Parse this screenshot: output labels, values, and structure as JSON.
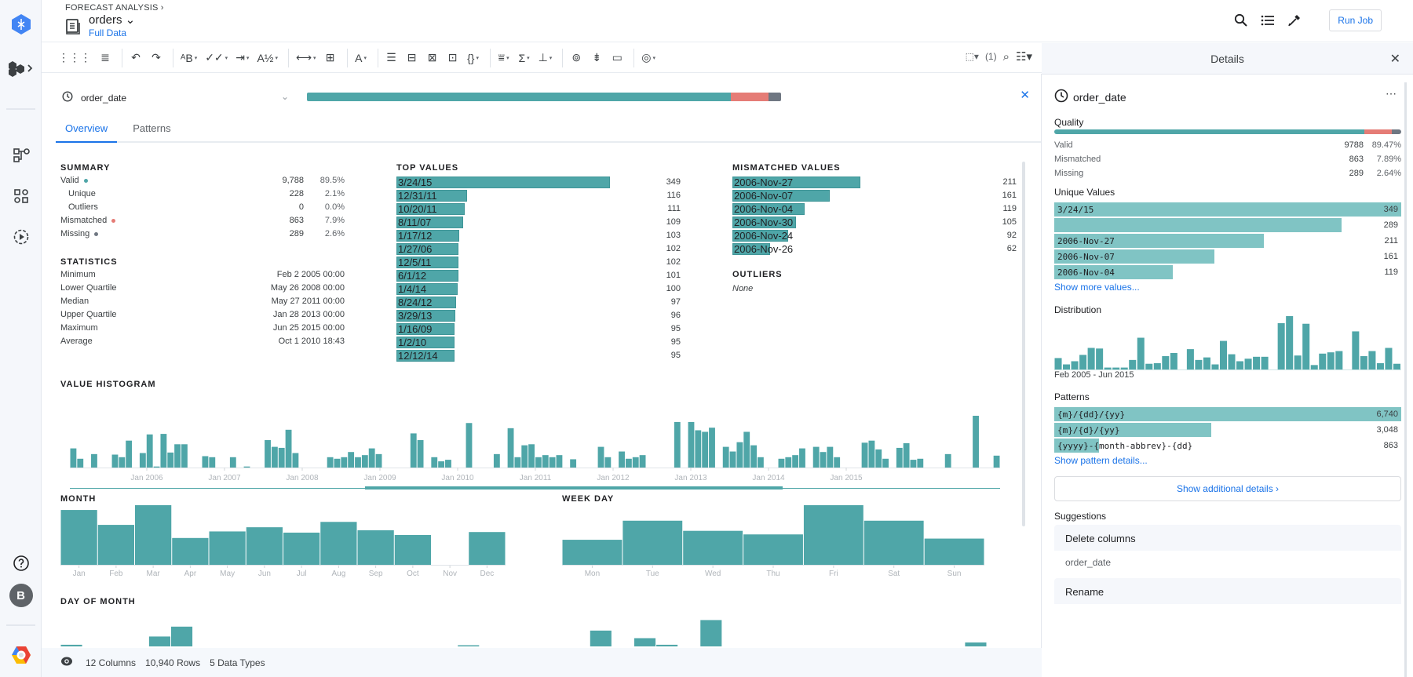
{
  "header": {
    "breadcrumb": "FORECAST ANALYSIS ›",
    "dataset_name": "orders ⌄",
    "dataset_sub": "Full Data",
    "run_job": "Run Job",
    "icons": [
      "search-icon",
      "list-icon",
      "eyedropper-icon"
    ]
  },
  "rail": {
    "avatar_letter": "B",
    "icons": [
      "dataprep-logo-icon",
      "flows-icon",
      "flow-diagram-icon",
      "grid-icon",
      "jobs-icon",
      "help-icon",
      "avatar",
      "gcp-logo-icon"
    ]
  },
  "toolbar": {
    "groups": [
      [
        {
          "name": "grid-view-icon",
          "glyph": "⋮⋮⋮"
        },
        {
          "name": "list-view-icon",
          "glyph": "≣"
        }
      ],
      [
        {
          "name": "undo-icon",
          "glyph": "↶"
        },
        {
          "name": "redo-icon",
          "glyph": "↷"
        }
      ],
      [
        {
          "name": "rename-icon",
          "glyph": "ᴬB",
          "caret": true
        },
        {
          "name": "validate-icon",
          "glyph": "✓✓",
          "caret": true
        },
        {
          "name": "move-icon",
          "glyph": "⇥",
          "caret": true
        },
        {
          "name": "sort-icon",
          "glyph": "A½",
          "caret": true
        }
      ],
      [
        {
          "name": "split-column-icon",
          "glyph": "⟷",
          "caret": true
        },
        {
          "name": "merge-column-icon",
          "glyph": "⊞"
        }
      ],
      [
        {
          "name": "text-format-icon",
          "glyph": "A",
          "caret": true
        }
      ],
      [
        {
          "name": "rows-icon",
          "glyph": "☰"
        },
        {
          "name": "unnest-icon",
          "glyph": "⊟"
        },
        {
          "name": "pivot-icon",
          "glyph": "⊠"
        },
        {
          "name": "transpose-icon",
          "glyph": "⊡"
        },
        {
          "name": "json-icon",
          "glyph": "{}",
          "caret": true
        }
      ],
      [
        {
          "name": "filter-icon",
          "glyph": "⩸",
          "caret": true
        },
        {
          "name": "aggregate-icon",
          "glyph": "Σ",
          "caret": true
        },
        {
          "name": "hierarchy-icon",
          "glyph": "⊥",
          "caret": true
        }
      ],
      [
        {
          "name": "join-icon",
          "glyph": "⊚"
        },
        {
          "name": "union-icon",
          "glyph": "⇟"
        },
        {
          "name": "comment-icon",
          "glyph": "▭"
        }
      ],
      [
        {
          "name": "macro-icon",
          "glyph": "◎",
          "caret": true
        }
      ]
    ],
    "selection_count": "(1)"
  },
  "column": {
    "name": "order_date",
    "quality": {
      "valid": 89.47,
      "mismatched": 7.89,
      "missing": 2.64
    },
    "tabs": [
      "Overview",
      "Patterns"
    ],
    "active_tab": 0
  },
  "summary": {
    "title": "SUMMARY",
    "rows": [
      {
        "label": "Valid",
        "value": "9,788",
        "pct": "89.5%",
        "dot": "#4fa6a8",
        "indent": false
      },
      {
        "label": "Unique",
        "value": "228",
        "pct": "2.1%",
        "indent": true
      },
      {
        "label": "Outliers",
        "value": "0",
        "pct": "0.0%",
        "indent": true
      },
      {
        "label": "Mismatched",
        "value": "863",
        "pct": "7.9%",
        "dot": "#e57c76",
        "indent": false
      },
      {
        "label": "Missing",
        "value": "289",
        "pct": "2.6%",
        "dot": "#6f7782",
        "indent": false
      }
    ]
  },
  "statistics": {
    "title": "STATISTICS",
    "rows": [
      {
        "label": "Minimum",
        "value": "Feb 2 2005 00:00"
      },
      {
        "label": "Lower Quartile",
        "value": "May 26 2008 00:00"
      },
      {
        "label": "Median",
        "value": "May 27 2011 00:00"
      },
      {
        "label": "Upper Quartile",
        "value": "Jan 28 2013 00:00"
      },
      {
        "label": "Maximum",
        "value": "Jun 25 2015 00:00"
      },
      {
        "label": "Average",
        "value": "Oct 1 2010 18:43"
      }
    ]
  },
  "top_values": {
    "title": "TOP VALUES",
    "items": [
      {
        "label": "3/24/15",
        "count": 349
      },
      {
        "label": "12/31/11",
        "count": 116
      },
      {
        "label": "10/20/11",
        "count": 111
      },
      {
        "label": "8/11/07",
        "count": 109
      },
      {
        "label": "1/17/12",
        "count": 103
      },
      {
        "label": "1/27/06",
        "count": 102
      },
      {
        "label": "12/5/11",
        "count": 102
      },
      {
        "label": "6/1/12",
        "count": 101
      },
      {
        "label": "1/4/14",
        "count": 100
      },
      {
        "label": "8/24/12",
        "count": 97
      },
      {
        "label": "3/29/13",
        "count": 96
      },
      {
        "label": "1/16/09",
        "count": 95
      },
      {
        "label": "1/2/10",
        "count": 95
      },
      {
        "label": "12/12/14",
        "count": 95
      }
    ]
  },
  "mismatched_values": {
    "title": "MISMATCHED VALUES",
    "items": [
      {
        "label": "2006-Nov-27",
        "count": 211
      },
      {
        "label": "2006-Nov-07",
        "count": 161
      },
      {
        "label": "2006-Nov-04",
        "count": 119
      },
      {
        "label": "2006-Nov-30",
        "count": 105
      },
      {
        "label": "2006-Nov-24",
        "count": 92
      },
      {
        "label": "2006-Nov-26",
        "count": 62
      }
    ]
  },
  "outliers": {
    "title": "OUTLIERS",
    "value": "None"
  },
  "chart_data": [
    {
      "type": "bar",
      "title": "VALUE HISTOGRAM",
      "x_ticks": [
        "Jan 2006",
        "Jan 2007",
        "Jan 2008",
        "Jan 2009",
        "Jan 2010",
        "Jan 2011",
        "Jan 2012",
        "Jan 2013",
        "Jan 2014",
        "Jan 2015"
      ],
      "values": [
        37,
        17,
        0,
        26,
        0,
        0,
        25,
        20,
        52,
        0,
        28,
        64,
        2,
        65,
        29,
        45,
        45,
        0,
        0,
        22,
        20,
        0,
        0,
        20,
        0,
        2,
        0,
        0,
        53,
        40,
        38,
        73,
        28,
        0,
        0,
        0,
        0,
        20,
        17,
        20,
        30,
        20,
        24,
        37,
        26,
        0,
        0,
        0,
        0,
        66,
        53,
        0,
        20,
        12,
        15,
        0,
        0,
        86,
        0,
        0,
        0,
        26,
        0,
        76,
        20,
        43,
        45,
        20,
        24,
        20,
        24,
        0,
        16,
        0,
        0,
        0,
        40,
        20,
        0,
        31,
        17,
        20,
        24,
        0,
        0,
        0,
        0,
        88,
        0,
        88,
        72,
        69,
        77,
        0,
        40,
        31,
        49,
        69,
        43,
        20,
        0,
        0,
        17,
        20,
        24,
        37,
        0,
        40,
        30,
        40,
        20,
        0,
        0,
        0,
        48,
        52,
        35,
        17,
        0,
        38,
        47,
        15,
        17,
        0,
        0,
        0,
        26,
        0,
        0,
        0,
        100,
        0,
        0,
        23
      ],
      "ylim": [
        0,
        100
      ]
    },
    {
      "type": "bar",
      "title": "MONTH",
      "categories": [
        "Jan",
        "Feb",
        "Mar",
        "Apr",
        "May",
        "Jun",
        "Jul",
        "Aug",
        "Sep",
        "Oct",
        "Nov",
        "Dec"
      ],
      "values": [
        92,
        67,
        100,
        45,
        56,
        63,
        54,
        72,
        58,
        50,
        0,
        55
      ],
      "ylim": [
        0,
        100
      ]
    },
    {
      "type": "bar",
      "title": "WEEK DAY",
      "categories": [
        "Mon",
        "Tue",
        "Wed",
        "Thu",
        "Fri",
        "Sat",
        "Sun"
      ],
      "values": [
        42,
        74,
        57,
        51,
        100,
        74,
        44
      ],
      "ylim": [
        0,
        100
      ]
    },
    {
      "type": "bar",
      "title": "DAY OF MONTH",
      "values": [
        5,
        0,
        0,
        0,
        30,
        60,
        0,
        0,
        0,
        0,
        0,
        0,
        0,
        0,
        0,
        0,
        0,
        0,
        3,
        0,
        0,
        0,
        0,
        0,
        48,
        0,
        25,
        5,
        0,
        80,
        0,
        0,
        0,
        0,
        0,
        0,
        0,
        0,
        0,
        0,
        0,
        12
      ],
      "ylim": [
        0,
        100
      ]
    }
  ],
  "footer": {
    "columns": "12 Columns",
    "rows": "10,940 Rows",
    "types": "5 Data Types"
  },
  "details": {
    "title": "Details",
    "column_name": "order_date",
    "quality_title": "Quality",
    "quality_rows": [
      {
        "label": "Valid",
        "count": "9788",
        "pct": "89.47%"
      },
      {
        "label": "Mismatched",
        "count": "863",
        "pct": "7.89%"
      },
      {
        "label": "Missing",
        "count": "289",
        "pct": "2.64%"
      }
    ],
    "unique_title": "Unique Values",
    "unique_values": [
      {
        "label": "3/24/15",
        "count": 349
      },
      {
        "label": "",
        "count": 289
      },
      {
        "label": "2006-Nov-27",
        "count": 211
      },
      {
        "label": "2006-Nov-07",
        "count": 161
      },
      {
        "label": "2006-Nov-04",
        "count": 119
      }
    ],
    "show_more_values": "Show more values...",
    "distribution_title": "Distribution",
    "distribution_range": "Feb 2005 - Jun 2015",
    "distribution_values": [
      18,
      8,
      13,
      23,
      34,
      33,
      3,
      3,
      3,
      15,
      50,
      9,
      10,
      21,
      26,
      0,
      32,
      15,
      19,
      8,
      45,
      24,
      13,
      17,
      20,
      20,
      0,
      73,
      84,
      22,
      72,
      7,
      25,
      27,
      29,
      0,
      60,
      21,
      29,
      10,
      34,
      9
    ],
    "patterns_title": "Patterns",
    "patterns": [
      {
        "label": "{m}/{dd}/{yy}",
        "count": "6,740",
        "fraction": 1.0
      },
      {
        "label": "{m}/{d}/{yy}",
        "count": "3,048",
        "fraction": 0.452
      },
      {
        "label": "{yyyy}-{month-abbrev}-{dd}",
        "count": "863",
        "fraction": 0.128
      }
    ],
    "show_pattern_details": "Show pattern details...",
    "additional_details": "Show additional details ›",
    "suggestions_title": "Suggestions",
    "suggestions": [
      {
        "title": "Delete columns",
        "body": "order_date"
      },
      {
        "title": "Rename",
        "body": ""
      }
    ]
  }
}
